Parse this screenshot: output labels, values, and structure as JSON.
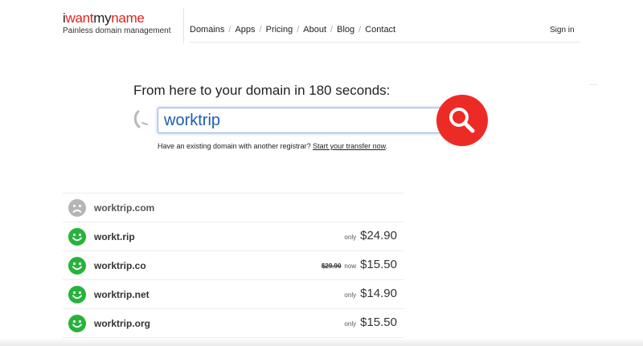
{
  "header": {
    "logo_part1": "i",
    "logo_part2": "want",
    "logo_part3": "my",
    "logo_part4": "name",
    "tagline": "Painless domain management",
    "nav": [
      {
        "label": "Domains"
      },
      {
        "label": "Apps"
      },
      {
        "label": "Pricing"
      },
      {
        "label": "About"
      },
      {
        "label": "Blog"
      },
      {
        "label": "Contact"
      }
    ],
    "nav_separator": "/",
    "signin_label": "Sign in"
  },
  "search": {
    "headline": "From here to your domain in 180 seconds:",
    "query": "worktrip",
    "transfer_text": "Have an existing domain with another registrar?",
    "transfer_link": "Start your transfer now",
    "transfer_period": "."
  },
  "results": [
    {
      "domain": "worktrip.com",
      "available": false,
      "old_price": "",
      "prefix": "",
      "price": ""
    },
    {
      "domain": "workt.rip",
      "available": true,
      "old_price": "",
      "prefix": "only",
      "price": "$24.90"
    },
    {
      "domain": "worktrip.co",
      "available": true,
      "old_price": "$29.90",
      "prefix": "now",
      "price": "$15.50"
    },
    {
      "domain": "worktrip.net",
      "available": true,
      "old_price": "",
      "prefix": "only",
      "price": "$14.90"
    },
    {
      "domain": "worktrip.org",
      "available": true,
      "old_price": "",
      "prefix": "only",
      "price": "$15.50"
    }
  ],
  "colors": {
    "brand_red": "#e3231b",
    "search_button": "#ed2b26",
    "available_green": "#27b33a",
    "unavailable_gray": "#b5b5b5",
    "query_blue": "#1a5fb4"
  },
  "icons": {
    "phone": "phone-icon",
    "search": "magnifier-icon",
    "available": "happy-face-icon",
    "unavailable": "sad-face-icon"
  }
}
